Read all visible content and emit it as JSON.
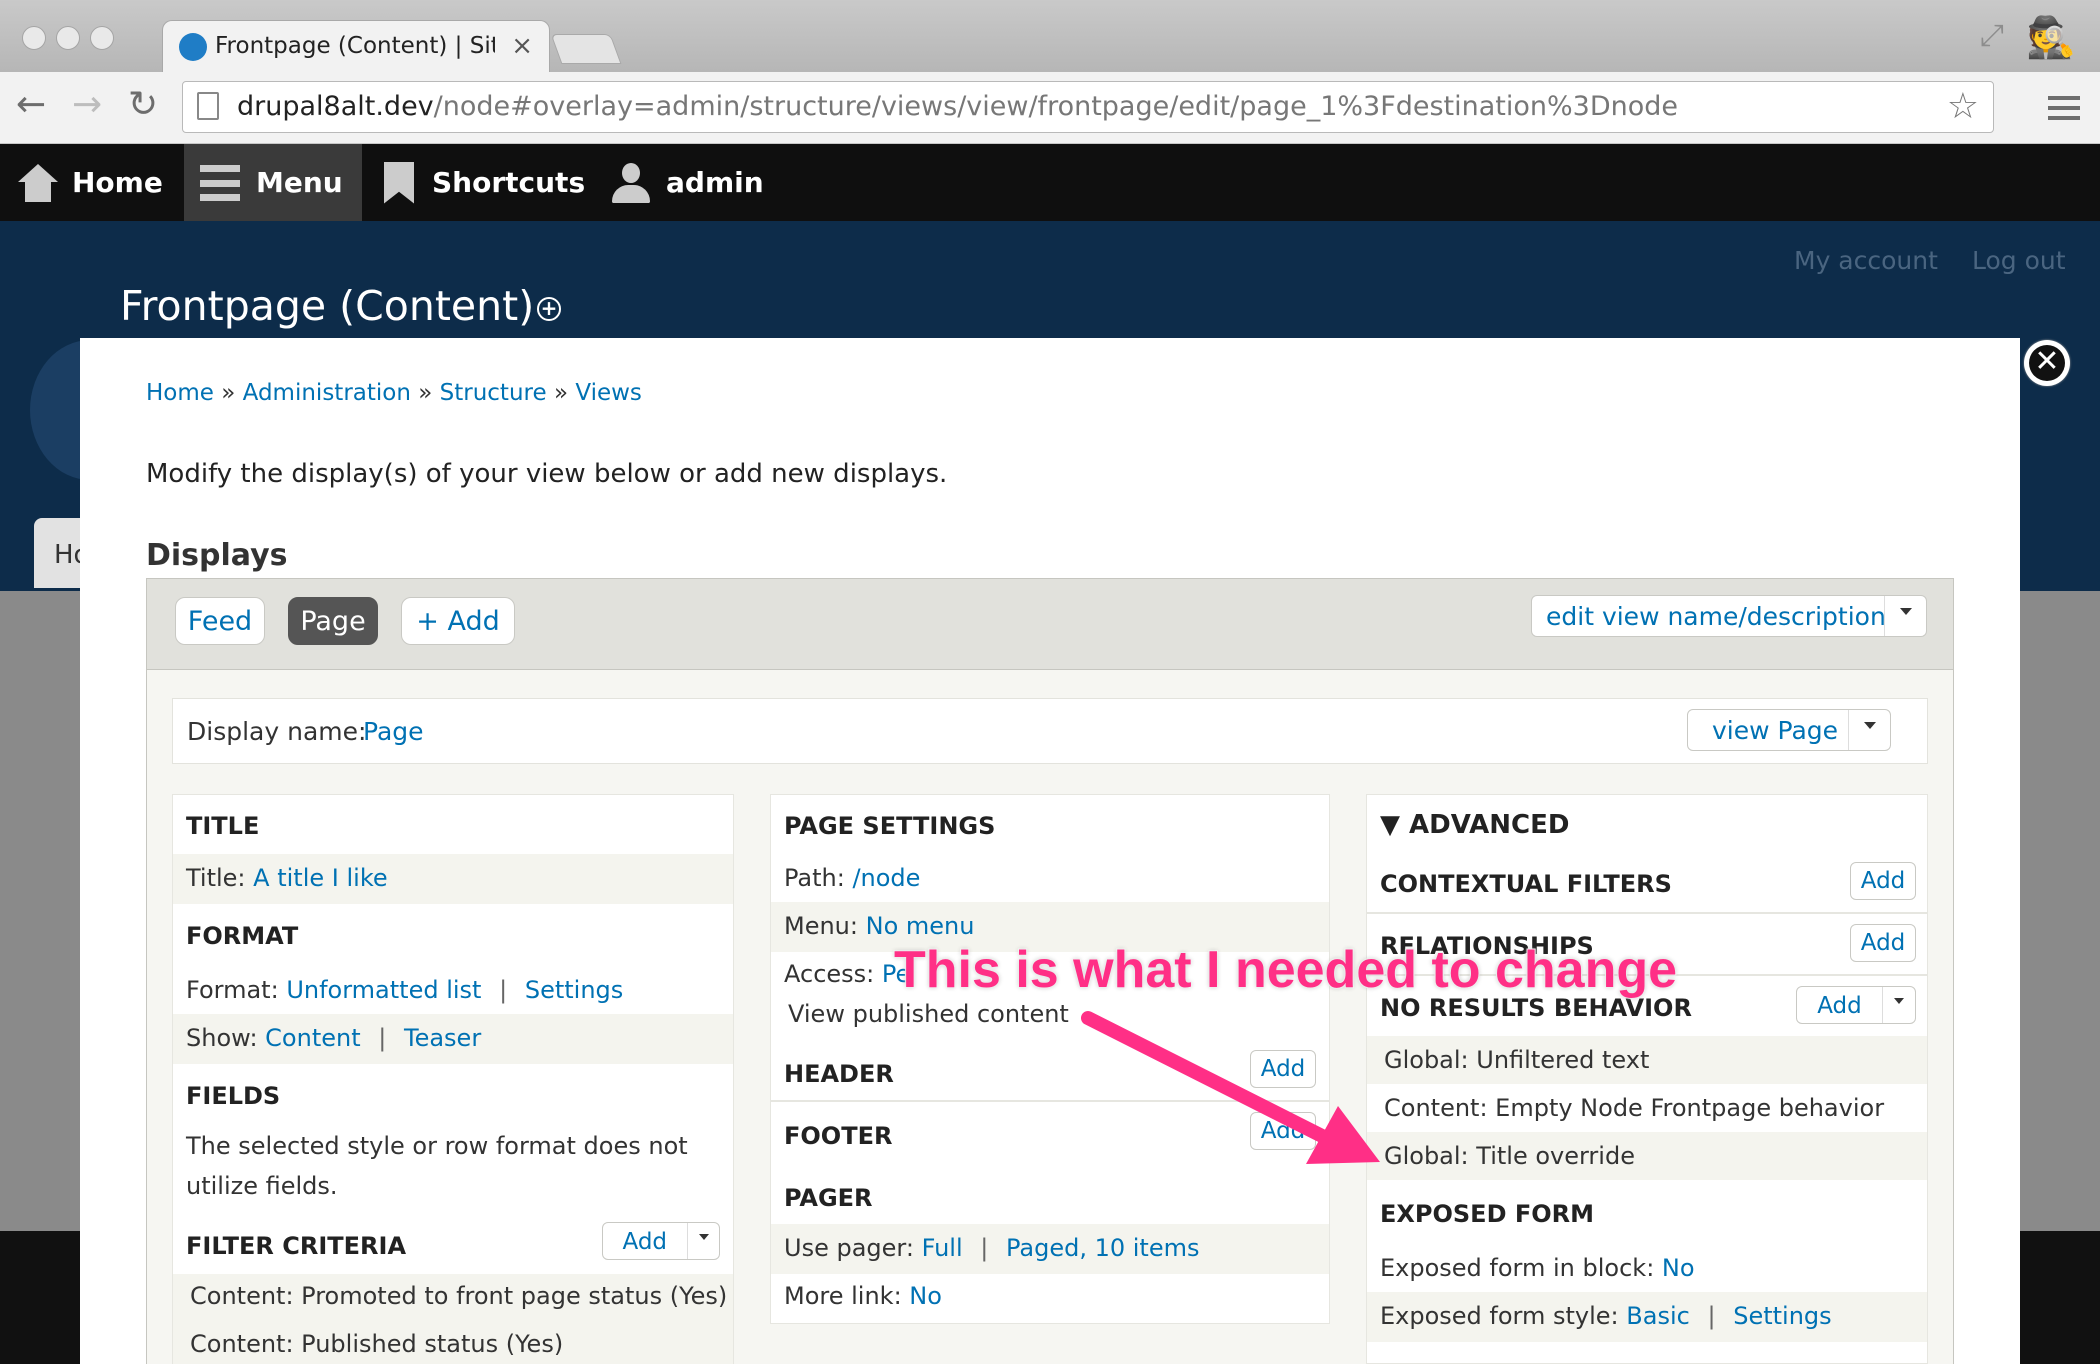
{
  "browser": {
    "tab_title": "Frontpage (Content) | Site-",
    "tab_close": "×",
    "url_host": "drupal8alt.dev",
    "url_path": "/node#overlay=admin/structure/views/view/frontpage/edit/page_1%3Fdestination%3Dnode",
    "back_glyph": "←",
    "forward_glyph": "→",
    "reload_glyph": "↻",
    "star_glyph": "☆",
    "fullscreen_glyph": "⤢",
    "incognito_glyph": "🕵"
  },
  "admin_toolbar": {
    "home": "Home",
    "menu": "Menu",
    "shortcuts": "Shortcuts",
    "user": "admin"
  },
  "header": {
    "my_account": "My account",
    "log_out": "Log out",
    "page_title": "Frontpage (Content)",
    "plus_glyph": "+",
    "peek_tab": "Ho"
  },
  "overlay": {
    "close_glyph": "✕",
    "breadcrumb": [
      "Home",
      "Administration",
      "Structure",
      "Views"
    ],
    "breadcrumb_sep": "»",
    "description": "Modify the display(s) of your view below or add new displays.",
    "displays_heading": "Displays",
    "display_tabs": [
      "Feed",
      "Page",
      "+ Add"
    ],
    "edit_view_label": "edit view name/description",
    "display_name_label": "Display name:",
    "display_name_value": "Page",
    "view_page_label": "view Page"
  },
  "left_column": {
    "title_heading": "TITLE",
    "title_label": "Title:",
    "title_value": "A title I like",
    "format_heading": "FORMAT",
    "format_label": "Format:",
    "format_value": "Unformatted list",
    "format_settings": "Settings",
    "show_label": "Show:",
    "show_value": "Content",
    "show_teaser": "Teaser",
    "fields_heading": "FIELDS",
    "fields_text": "The selected style or row format does not utilize fields.",
    "filter_heading": "FILTER CRITERIA",
    "filter_add": "Add",
    "filter_items": [
      "Content: Promoted to front page status (Yes)",
      "Content: Published status (Yes)"
    ],
    "separator": "|"
  },
  "middle_column": {
    "page_settings_heading": "PAGE SETTINGS",
    "path_label": "Path:",
    "path_value": "/node",
    "menu_label": "Menu:",
    "menu_value": "No menu",
    "access_label": "Access:",
    "access_value": "Pe",
    "access_link": "View published content",
    "header_heading": "HEADER",
    "header_add": "Add",
    "footer_heading": "FOOTER",
    "footer_add": "Add",
    "pager_heading": "PAGER",
    "use_pager_label": "Use pager:",
    "use_pager_value": "Full",
    "pager_paged": "Paged, 10 items",
    "more_link_label": "More link:",
    "more_link_value": "No"
  },
  "right_column": {
    "advanced_heading": "▼ ADVANCED",
    "contextual_heading": "CONTEXTUAL FILTERS",
    "contextual_add": "Add",
    "relationships_heading": "RELATIONSHIPS",
    "relationships_add": "Add",
    "no_results_heading": "NO RESULTS BEHAVIOR",
    "no_results_add": "Add",
    "no_results_items": [
      "Global: Unfiltered text",
      "Content: Empty Node Frontpage behavior",
      "Global: Title override"
    ],
    "exposed_heading": "EXPOSED FORM",
    "exposed_block_label": "Exposed form in block:",
    "exposed_block_value": "No",
    "exposed_style_label": "Exposed form style:",
    "exposed_style_value": "Basic",
    "exposed_style_settings": "Settings"
  },
  "annotation": {
    "text": "This is what I needed to change",
    "color": "#ff2f86"
  },
  "colors": {
    "link": "#0071b3",
    "header_bg": "#0d2c4a",
    "toolbar_bg": "#0f0f0f"
  }
}
